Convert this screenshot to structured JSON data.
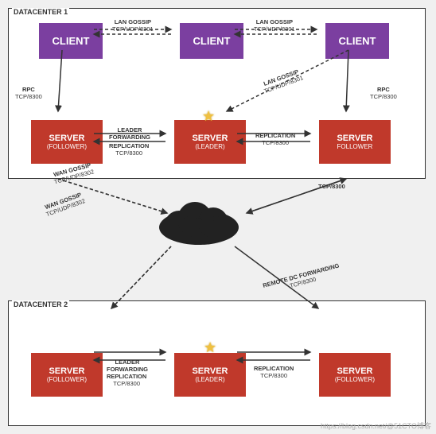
{
  "dc1": {
    "label": "DATACENTER 1",
    "clients": [
      {
        "label": "CLIENT",
        "id": "c1"
      },
      {
        "label": "CLIENT",
        "id": "c2"
      },
      {
        "label": "CLIENT",
        "id": "c3"
      }
    ],
    "servers": [
      {
        "label": "SERVER",
        "sub": "(FOLLOWER)",
        "id": "s1"
      },
      {
        "label": "SERVER",
        "sub": "(LEADER)",
        "id": "s2"
      },
      {
        "label": "SERVER",
        "sub": "FOLLOWER",
        "id": "s3"
      }
    ]
  },
  "dc2": {
    "label": "DATACENTER 2",
    "servers": [
      {
        "label": "SERVER",
        "sub": "(FOLLOWER)",
        "id": "s4"
      },
      {
        "label": "SERVER",
        "sub": "(LEADER)",
        "id": "s5"
      },
      {
        "label": "SERVER",
        "sub": "(FOLLOWER)",
        "id": "s6"
      }
    ]
  },
  "internet": {
    "label": "INTERNET"
  },
  "arrow_labels": {
    "lan_gossip": "LAN GOSSIP",
    "tcp_udp_8301": "TCP/UDP/8301",
    "tcp_8300": "TCP/8300",
    "tcp_8302": "TCP/UDP/8302",
    "rpc": "RPC",
    "leader_forwarding": "LEADER\nFORWARDING",
    "replication": "REPLICATION",
    "wan_gossip": "WAN GOSSIP",
    "remote_dc_forwarding": "REMOTE DC FORWARDING"
  },
  "watermark": "https://blog.csdn.net/@51CTO博客"
}
